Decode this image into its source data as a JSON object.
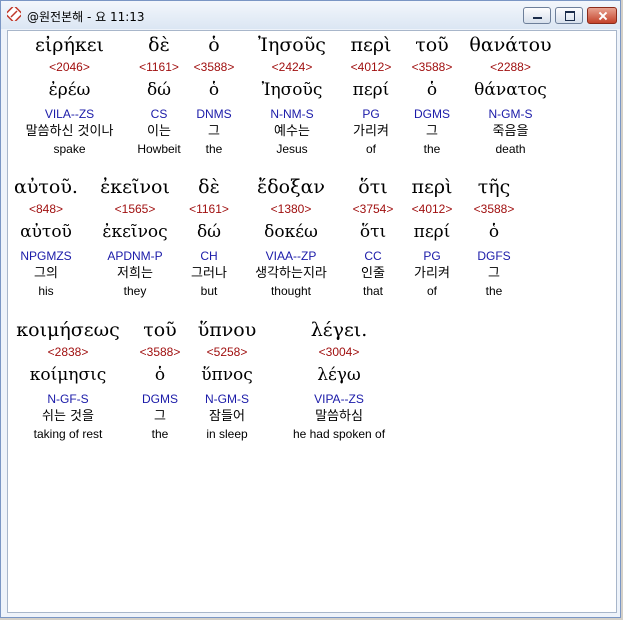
{
  "window": {
    "title": "@원전본해 - 요 11:13"
  },
  "rows": [
    {
      "words": [
        {
          "greek": "εἰρήκει",
          "strong": "<2046>",
          "lemma": "ἐρέω",
          "morph": "VILA--ZS",
          "korean": "말씀하신 것이나",
          "english": "spake"
        },
        {
          "greek": "δὲ",
          "strong": "<1161>",
          "lemma": "δώ",
          "morph": "CS",
          "korean": "이는",
          "english": "Howbeit"
        },
        {
          "greek": "ὁ",
          "strong": "<3588>",
          "lemma": "ὁ",
          "morph": "DNMS",
          "korean": "그",
          "english": "the"
        },
        {
          "greek": "Ἰησοῦς",
          "strong": "<2424>",
          "lemma": "Ἰησοῦς",
          "morph": "N-NM-S",
          "korean": "예수는",
          "english": "Jesus"
        },
        {
          "greek": "περὶ",
          "strong": "<4012>",
          "lemma": "περί",
          "morph": "PG",
          "korean": "가리켜",
          "english": "of"
        },
        {
          "greek": "τοῦ",
          "strong": "<3588>",
          "lemma": "ὁ",
          "morph": "DGMS",
          "korean": "그",
          "english": "the"
        },
        {
          "greek": "θανάτου",
          "strong": "<2288>",
          "lemma": "θάνατος",
          "morph": "N-GM-S",
          "korean": "죽음을",
          "english": "death"
        }
      ]
    },
    {
      "words": [
        {
          "greek": "αὐτοῦ.",
          "strong": "<848>",
          "lemma": "αὐτοῦ",
          "morph": "NPGMZS",
          "korean": "그의",
          "english": "his"
        },
        {
          "greek": "ἐκεῖνοι",
          "strong": "<1565>",
          "lemma": "ἐκεῖνος",
          "morph": "APDNM-P",
          "korean": "저희는",
          "english": "they"
        },
        {
          "greek": "δὲ",
          "strong": "<1161>",
          "lemma": "δώ",
          "morph": "CH",
          "korean": "그러나",
          "english": "but"
        },
        {
          "greek": "ἔδοξαν",
          "strong": "<1380>",
          "lemma": "δοκέω",
          "morph": "VIAA--ZP",
          "korean": "생각하는지라",
          "english": "thought"
        },
        {
          "greek": "ὅτι",
          "strong": "<3754>",
          "lemma": "ὅτι",
          "morph": "CC",
          "korean": "인줄",
          "english": "that"
        },
        {
          "greek": "περὶ",
          "strong": "<4012>",
          "lemma": "περί",
          "morph": "PG",
          "korean": "가리켜",
          "english": "of"
        },
        {
          "greek": "τῆς",
          "strong": "<3588>",
          "lemma": "ὁ",
          "morph": "DGFS",
          "korean": "그",
          "english": "the"
        }
      ]
    },
    {
      "words": [
        {
          "greek": "κοιμήσεως",
          "strong": "<2838>",
          "lemma": "κοίμησις",
          "morph": "N-GF-S",
          "korean": "쉬는 것을",
          "english": "taking of rest"
        },
        {
          "greek": "τοῦ",
          "strong": "<3588>",
          "lemma": "ὁ",
          "morph": "DGMS",
          "korean": "그",
          "english": "the"
        },
        {
          "greek": "ὕπνου",
          "strong": "<5258>",
          "lemma": "ὕπνος",
          "morph": "N-GM-S",
          "korean": "잠들어",
          "english": "in sleep"
        },
        {
          "greek": "λέγει.",
          "strong": "<3004>",
          "lemma": "λέγω",
          "morph": "VIPA--ZS",
          "korean": "말씀하심",
          "english": "he had spoken of"
        }
      ]
    }
  ]
}
